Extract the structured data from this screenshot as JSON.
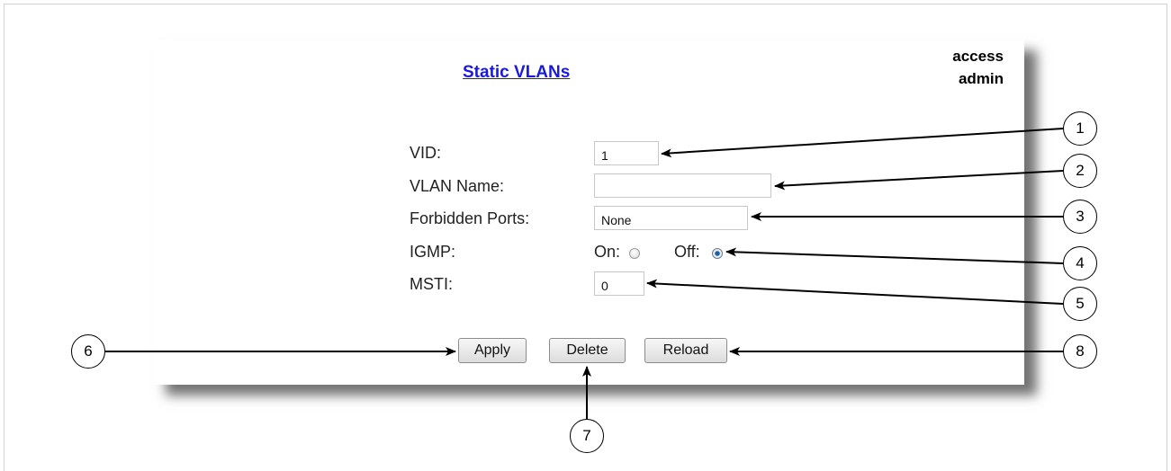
{
  "header": {
    "title": "Static VLANs",
    "user_line1": "access",
    "user_line2": "admin"
  },
  "form": {
    "vid_label": "VID:",
    "vid_value": "1",
    "vlan_name_label": "VLAN Name:",
    "vlan_name_value": "",
    "forbidden_ports_label": "Forbidden Ports:",
    "forbidden_ports_value": "None",
    "igmp_label": "IGMP:",
    "igmp_on_label": "On:",
    "igmp_off_label": "Off:",
    "igmp_selected": "Off",
    "msti_label": "MSTI:",
    "msti_value": "0"
  },
  "buttons": {
    "apply": "Apply",
    "delete": "Delete",
    "reload": "Reload"
  },
  "callouts": [
    "1",
    "2",
    "3",
    "4",
    "5",
    "6",
    "7",
    "8"
  ]
}
